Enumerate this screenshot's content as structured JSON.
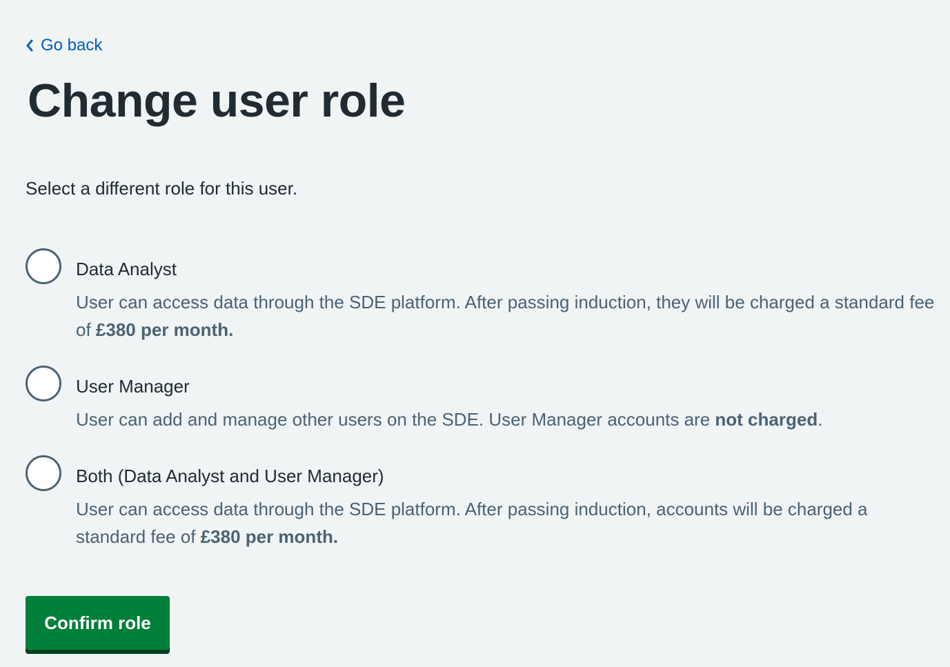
{
  "back_link": {
    "label": "Go back",
    "icon": "chevron-left-icon",
    "color": "#005eb8"
  },
  "page_title": "Change user role",
  "hint": "Select a different role for this user.",
  "options": [
    {
      "label": "Data Analyst",
      "hint_text": "User can access data through the SDE platform. After passing induction, they will be charged a standard fee of ",
      "hint_bold": "£380 per month.",
      "hint_after": "",
      "selected": false
    },
    {
      "label": "User Manager",
      "hint_text": "User can add and manage other users on the SDE. User Manager accounts are ",
      "hint_bold": "not charged",
      "hint_after": ".",
      "selected": false
    },
    {
      "label": "Both (Data Analyst and User Manager)",
      "hint_text": "User can access data through the SDE platform. After passing induction, accounts will be charged a standard fee of ",
      "hint_bold": "£380 per month.",
      "hint_after": "",
      "selected": false
    }
  ],
  "confirm_button": {
    "label": "Confirm role",
    "color": "#007f3b"
  },
  "colors": {
    "background": "#f0f4f5",
    "text": "#212b32",
    "secondary_text": "#4c6272",
    "link": "#005eb8",
    "button": "#007f3b",
    "button_shadow": "#00401e"
  }
}
